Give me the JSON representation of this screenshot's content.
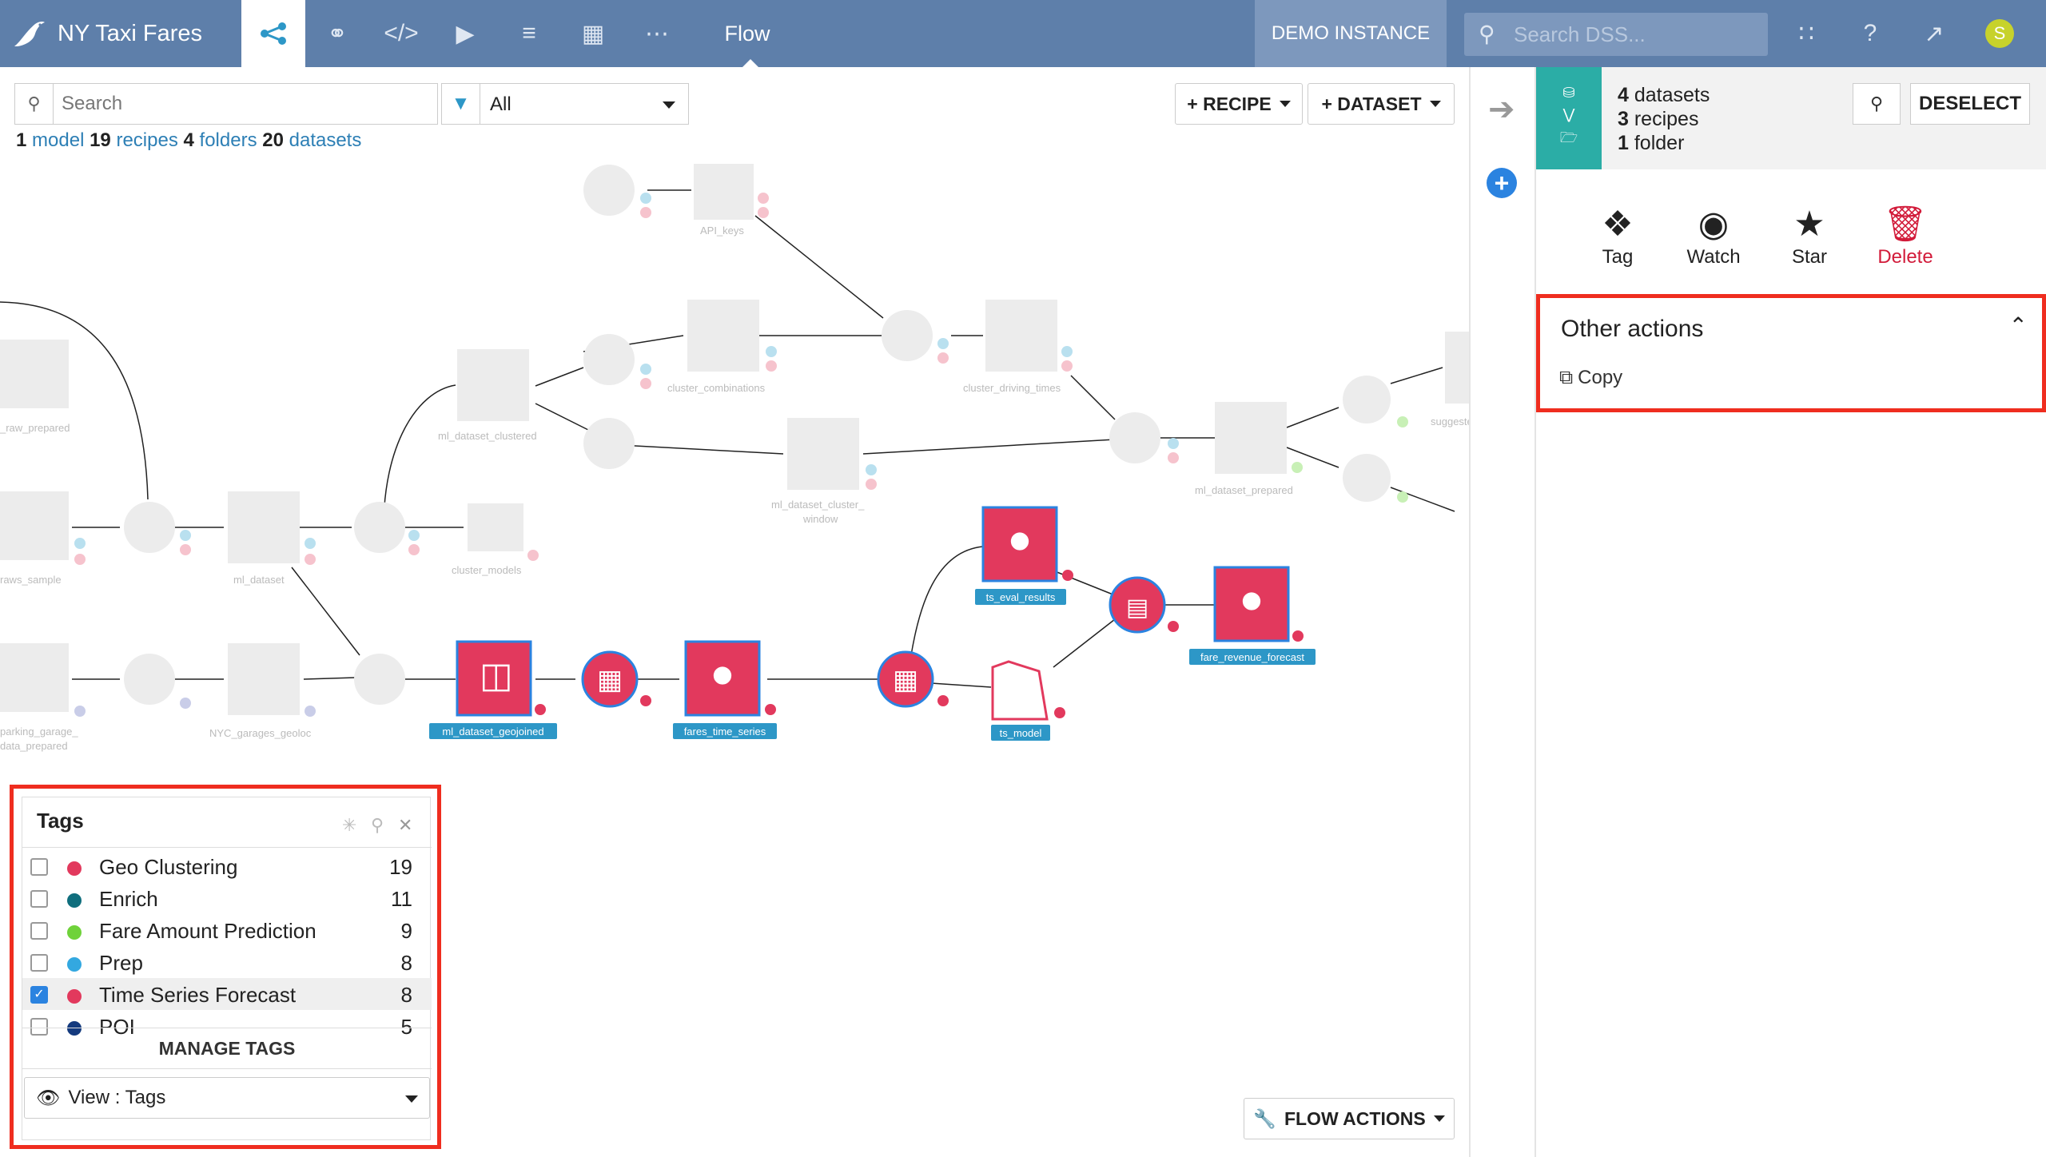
{
  "topbar": {
    "project_title": "NY Taxi Fares",
    "flow_label": "Flow",
    "demo_instance": "DEMO INSTANCE",
    "search_placeholder": "Search DSS...",
    "avatar_letter": "S"
  },
  "toolbar": {
    "search_placeholder": "Search",
    "filter_value": "All",
    "recipe_button": "+ RECIPE",
    "dataset_button": "+ DATASET"
  },
  "summary": {
    "model_count": "1",
    "model_label": "model",
    "recipe_count": "19",
    "recipe_label": "recipes",
    "folder_count": "4",
    "folder_label": "folders",
    "dataset_count": "20",
    "dataset_label": "datasets"
  },
  "flow": {
    "highlighted_labels": {
      "ml_dataset_geojoined": "ml_dataset_geojoined",
      "fares_time_series": "fares_time_series",
      "ts_eval_results": "ts_eval_results",
      "ts_model": "ts_model",
      "fare_revenue_forecast": "fare_revenue_forecast"
    },
    "faded_labels": {
      "api_keys": "API_keys",
      "cluster_combinations": "cluster_combinations",
      "cluster_driving_times": "cluster_driving_times",
      "ml_dataset_clustered": "ml_dataset_clustered",
      "ml_dataset_cluster_window_1": "ml_dataset_cluster_",
      "ml_dataset_cluster_window_2": "window",
      "ml_dataset_prepared": "ml_dataset_prepared",
      "raw_prepared": "_raw_prepared",
      "sample": "raws_sample",
      "ml_dataset": "ml_dataset",
      "cluster_models": "cluster_models",
      "parking_1": "parking_garage_",
      "parking_2": "data_prepared",
      "nyc_garages": "NYC_garages_geoloc",
      "suggested": "suggeste"
    },
    "flow_actions_button": "FLOW ACTIONS",
    "colors": {
      "time_series_forecast": "#e2395d",
      "faded_node": "#ececec"
    }
  },
  "selection": {
    "datasets_count": "4",
    "datasets_label": "datasets",
    "recipes_count": "3",
    "recipes_label": "recipes",
    "folder_count": "1",
    "folder_label": "folder",
    "deselect_button": "DESELECT",
    "actions": {
      "tag": "Tag",
      "watch": "Watch",
      "star": "Star",
      "delete": "Delete"
    },
    "other_actions_title": "Other actions",
    "copy_label": "Copy"
  },
  "tags_panel": {
    "title": "Tags",
    "items": [
      {
        "name": "Geo Clustering",
        "count": "19",
        "color": "#e2395d",
        "checked": false
      },
      {
        "name": "Enrich",
        "count": "11",
        "color": "#0f6e7d",
        "checked": false
      },
      {
        "name": "Fare Amount Prediction",
        "count": "9",
        "color": "#6fd23a",
        "checked": false
      },
      {
        "name": "Prep",
        "count": "8",
        "color": "#33a8e0",
        "checked": false
      },
      {
        "name": "Time Series Forecast",
        "count": "8",
        "color": "#e2395d",
        "checked": true
      },
      {
        "name": "POI",
        "count": "5",
        "color": "#143a7e",
        "checked": false
      }
    ],
    "manage_tags": "MANAGE TAGS",
    "view_select": "View : Tags"
  }
}
